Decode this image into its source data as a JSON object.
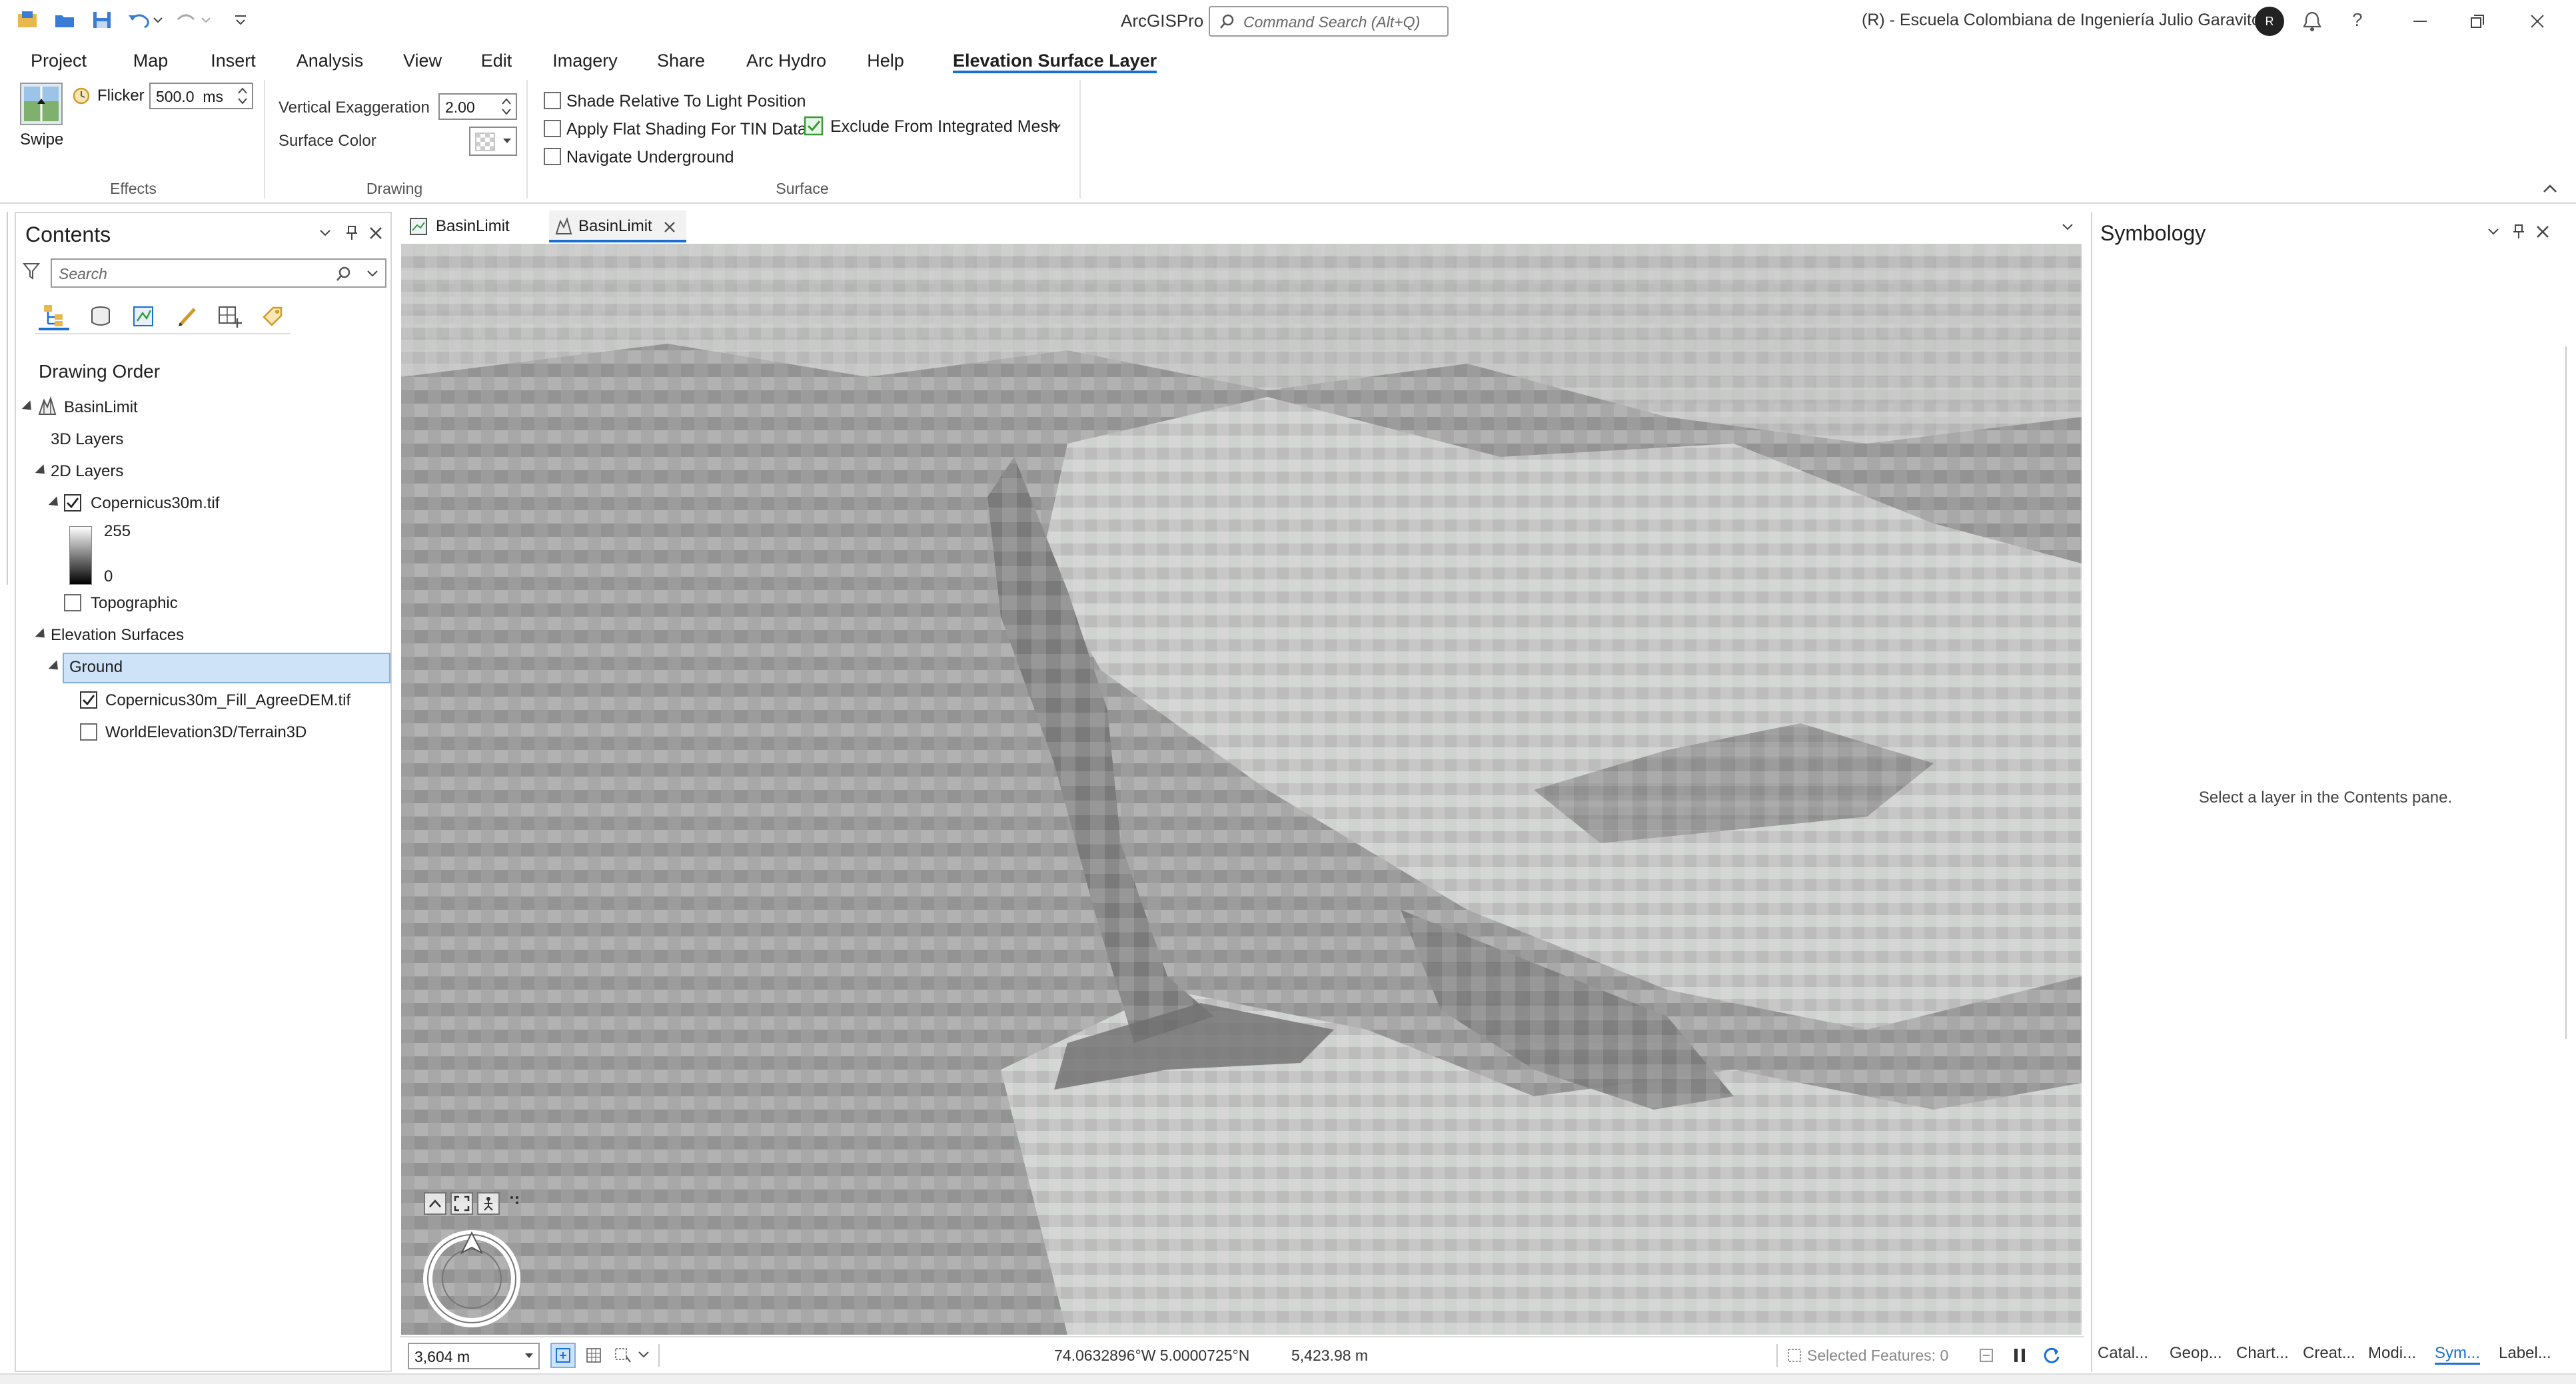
{
  "app": {
    "title": "ArcGISPro",
    "command_search_placeholder": "Command Search (Alt+Q)",
    "org": "(R) - Escuela Colombiana de Ingeniería Julio Garavito",
    "avatar_initial": "R"
  },
  "ribbon_tabs": [
    "Project",
    "Map",
    "Insert",
    "Analysis",
    "View",
    "Edit",
    "Imagery",
    "Share",
    "Arc Hydro",
    "Help",
    "Elevation Surface Layer"
  ],
  "ribbon": {
    "effects": {
      "swipe_label": "Swipe",
      "flicker_label": "Flicker",
      "flicker_value": "500.0  ms",
      "group_label": "Effects"
    },
    "drawing": {
      "vert_exag_label": "Vertical Exaggeration",
      "vert_exag_value": "2.00",
      "surface_color_label": "Surface Color",
      "group_label": "Drawing"
    },
    "surface": {
      "shade_relative": "Shade Relative To Light Position",
      "flat_shading": "Apply Flat Shading For TIN Data",
      "navigate_underground": "Navigate Underground",
      "exclude_mesh": "Exclude From Integrated Mesh",
      "group_label": "Surface"
    }
  },
  "contents": {
    "title": "Contents",
    "search_placeholder": "Search",
    "drawing_order": "Drawing Order",
    "items": {
      "basin": "BasinLimit",
      "layers3d": "3D Layers",
      "layers2d": "2D Layers",
      "copernicus": "Copernicus30m.tif",
      "legend_max": "255",
      "legend_min": "0",
      "topographic": "Topographic",
      "elevation_surfaces": "Elevation Surfaces",
      "ground": "Ground",
      "fill_dem": "Copernicus30m_Fill_AgreeDEM.tif",
      "world_elev": "WorldElevation3D/Terrain3D"
    }
  },
  "map_tabs": [
    "BasinLimit",
    "BasinLimit"
  ],
  "status": {
    "scale": "3,604 m",
    "coords": "74.0632896°W 5.0000725°N",
    "elevation": "5,423.98 m",
    "selected": "Selected Features: 0"
  },
  "symbology": {
    "title": "Symbology",
    "hint": "Select a layer in the Contents pane."
  },
  "bottom_tabs": [
    "Catal...",
    "Geop...",
    "Chart...",
    "Creat...",
    "Modi...",
    "Sym...",
    "Label..."
  ],
  "colors": {
    "accent": "#1a6fd4",
    "selection": "#cfe3f8",
    "selection_border": "#7fb0e3"
  }
}
